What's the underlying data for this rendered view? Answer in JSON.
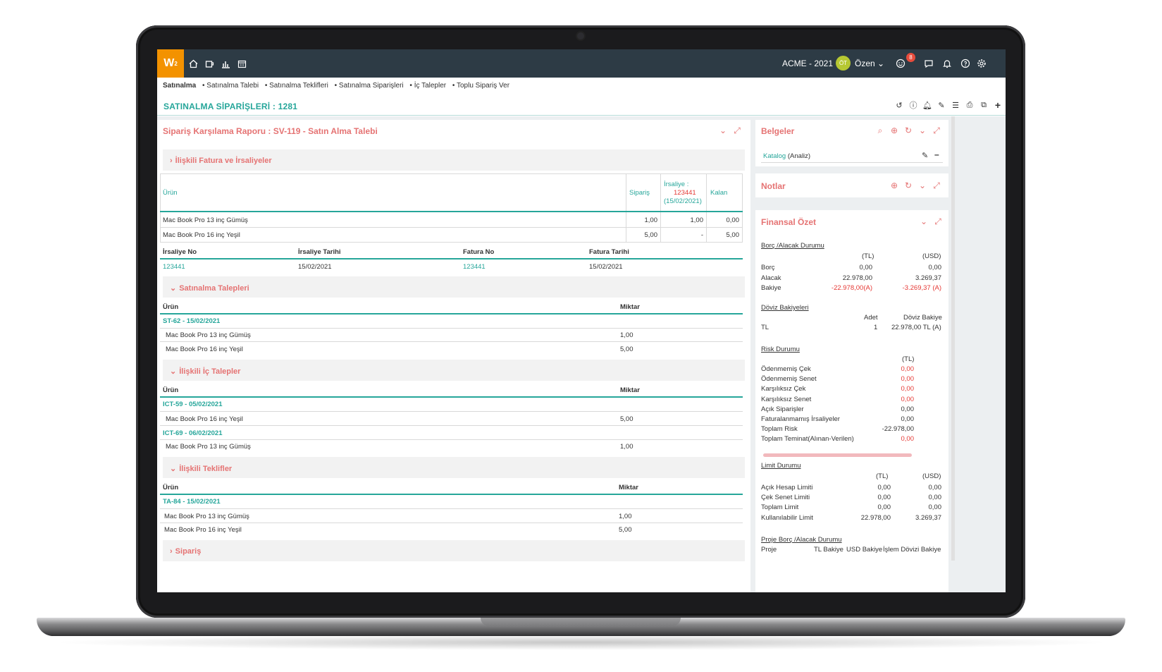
{
  "topbar": {
    "logo": "W",
    "company": "ACME - 2021",
    "avatar_initials": "ÖT",
    "user_name": "Özen",
    "notification_count": "8",
    "icons": [
      "home-icon",
      "cup-icon",
      "chart-icon",
      "calendar-icon",
      "smiley-icon",
      "chat-icon",
      "bell-icon",
      "help-icon",
      "gear-icon"
    ]
  },
  "breadcrumb": [
    "Satınalma",
    "• Satınalma Talebi",
    "• Satınalma Teklifleri",
    "• Satınalma Siparişleri",
    "• İç Talepler",
    "• Toplu Sipariş Ver"
  ],
  "page_title": "SATINALMA SİPARİŞLERİ : 1281",
  "main_panel": {
    "title": "Sipariş Karşılama Raporu : SV-119 - Satın Alma Talebi",
    "s1": {
      "title": "İlişkili Fatura ve İrsaliyeler",
      "col_urun": "Ürün",
      "col_siparis": "Sipariş",
      "col_irsaliye_l1": "İrsaliye :",
      "col_irsaliye_no": "123441",
      "col_irsaliye_date": "(15/02/2021)",
      "col_kalan": "Kalan",
      "rows": [
        {
          "urun": "Mac Book Pro 13 inç Gümüş",
          "siparis": "1,00",
          "irsaliye": "1,00",
          "kalan": "0,00"
        },
        {
          "urun": "Mac Book Pro 16 inç Yeşil",
          "siparis": "5,00",
          "irsaliye": "-",
          "kalan": "5,00"
        }
      ],
      "h_irsaliye_no": "İrsaliye No",
      "h_irsaliye_tarihi": "İrsaliye Tarihi",
      "h_fatura_no": "Fatura No",
      "h_fatura_tarihi": "Fatura Tarihi",
      "doc_row": {
        "irsaliye_no": "123441",
        "irsaliye_tarihi": "15/02/2021",
        "fatura_no": "123441",
        "fatura_tarihi": "15/02/2021"
      }
    },
    "s2": {
      "title": "Satınalma Talepleri",
      "col_urun": "Ürün",
      "col_miktar": "Miktar",
      "group": "ST-62 - 15/02/2021",
      "rows": [
        {
          "urun": "Mac Book Pro 13 inç Gümüş",
          "miktar": "1,00"
        },
        {
          "urun": "Mac Book Pro 16 inç Yeşil",
          "miktar": "5,00"
        }
      ]
    },
    "s3": {
      "title": "İlişkili İç Talepler",
      "col_urun": "Ürün",
      "col_miktar": "Miktar",
      "group1": "ICT-59 - 05/02/2021",
      "row1": {
        "urun": "Mac Book Pro 16 inç Yeşil",
        "miktar": "5,00"
      },
      "group2": "ICT-69 - 06/02/2021",
      "row2": {
        "urun": "Mac Book Pro 13 inç Gümüş",
        "miktar": "1,00"
      }
    },
    "s4": {
      "title": "İlişkili Teklifler",
      "col_urun": "Ürün",
      "col_miktar": "Miktar",
      "group": "TA-84 - 15/02/2021",
      "rows": [
        {
          "urun": "Mac Book Pro 13 inç Gümüş",
          "miktar": "1,00"
        },
        {
          "urun": "Mac Book Pro 16 inç Yeşil",
          "miktar": "5,00"
        }
      ]
    },
    "s5": {
      "title": "Sipariş"
    }
  },
  "belgeler": {
    "title": "Belgeler",
    "link": "Katalog",
    "suffix": "(Analiz)"
  },
  "notlar": {
    "title": "Notlar"
  },
  "finansal": {
    "title": "Finansal Özet",
    "borc_title": "Borç /Alacak Durumu",
    "tl": "(TL)",
    "usd": "(USD)",
    "borc_rows": [
      {
        "label": "Borç",
        "tl": "0,00",
        "usd": "0,00"
      },
      {
        "label": "Alacak",
        "tl": "22.978,00",
        "usd": "3.269,37"
      },
      {
        "label": "Bakiye",
        "tl": "-22.978,00(A)",
        "usd": "-3.269,37 (A)"
      }
    ],
    "doviz_title": "Döviz Bakiyeleri",
    "doviz_h_adet": "Adet",
    "doviz_h_bakiye": "Döviz Bakiye",
    "doviz_row": {
      "label": "TL",
      "adet": "1",
      "bakiye": "22.978,00 TL (A)"
    },
    "risk_title": "Risk Durumu",
    "risk_tl": "(TL)",
    "risk_rows": [
      {
        "label": "Ödenmemiş Çek",
        "val": "0,00",
        "red": true
      },
      {
        "label": "Ödenmemiş Senet",
        "val": "0,00",
        "red": true
      },
      {
        "label": "Karşılıksız Çek",
        "val": "0,00",
        "red": true
      },
      {
        "label": "Karşılıksız Senet",
        "val": "0,00",
        "red": true
      },
      {
        "label": "Açık Siparişler",
        "val": "0,00",
        "red": false
      },
      {
        "label": "Faturalanmamış İrsaliyeler",
        "val": "0,00",
        "red": false
      },
      {
        "label": "Toplam Risk",
        "val": "-22.978,00",
        "red": false
      },
      {
        "label": "Toplam Teminat(Alınan-Verilen)",
        "val": "0,00",
        "red": true
      }
    ],
    "limit_title": "Limit Durumu",
    "limit_tl": "(TL)",
    "limit_usd": "(USD)",
    "limit_rows": [
      {
        "label": "Açık Hesap Limiti",
        "tl": "0,00",
        "usd": "0,00"
      },
      {
        "label": "Çek Senet Limiti",
        "tl": "0,00",
        "usd": "0,00"
      },
      {
        "label": "Toplam Limit",
        "tl": "0,00",
        "usd": "0,00"
      },
      {
        "label": "Kullanılabilir Limit",
        "tl": "22.978,00",
        "usd": "3.269,37"
      }
    ],
    "proje_title": "Proje Borç /Alacak Durumu",
    "proje_h": [
      "Proje",
      "TL Bakiye",
      "USD Bakiye",
      "İşlem Dövizi Bakiye"
    ]
  }
}
